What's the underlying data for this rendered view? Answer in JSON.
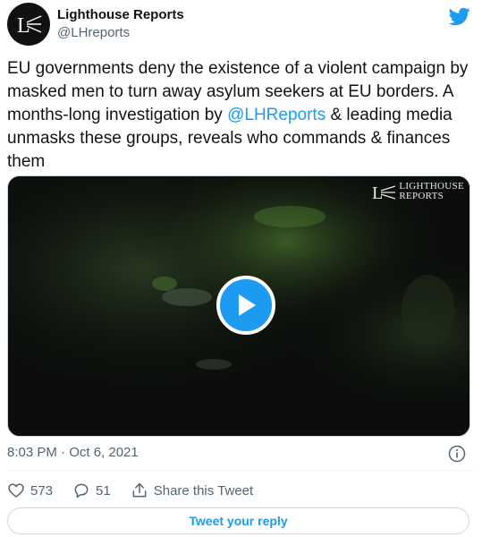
{
  "author": {
    "display_name": "Lighthouse Reports",
    "handle": "@LHreports",
    "avatar_text": "L"
  },
  "tweet": {
    "text_before": "EU governments deny the existence of a violent campaign by masked men to turn away asylum seekers at EU borders. A months-long investigation by ",
    "mention": "@LHReports",
    "text_after": " & leading media unmasks these groups, reveals who commands & finances them"
  },
  "media": {
    "watermark_line1": "LIGHTHOUSE",
    "watermark_line2": "REPORTS",
    "play_icon": "play-icon"
  },
  "timestamp": "8:03 PM · Oct 6, 2021",
  "actions": {
    "likes_count": "573",
    "replies_count": "51",
    "share_label": "Share this Tweet"
  },
  "reply_button_label": "Tweet your reply",
  "colors": {
    "accent": "#1d9bf0",
    "text": "#0f1419",
    "secondary": "#536471",
    "border": "#cfd9de"
  }
}
